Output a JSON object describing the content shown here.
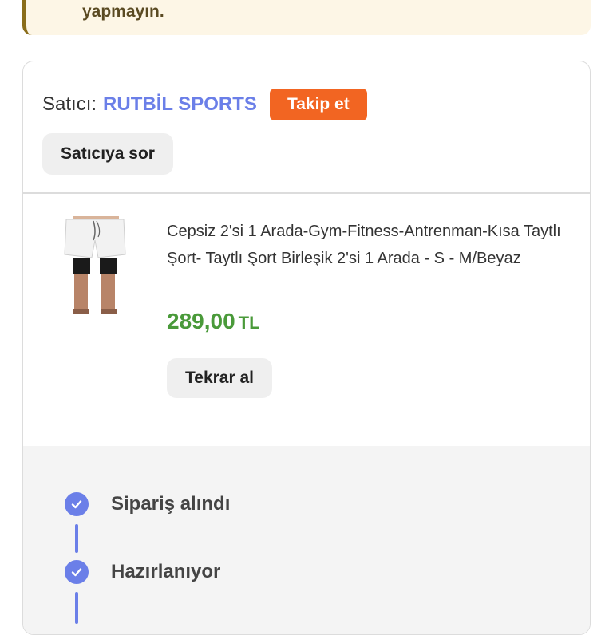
{
  "notice": {
    "text": "yapmayın."
  },
  "seller": {
    "prefix": "Satıcı:",
    "name": "RUTBİL SPORTS",
    "follow_label": "Takip et",
    "ask_label": "Satıcıya sor"
  },
  "product": {
    "title": "Cepsiz 2'si 1 Arada-Gym-Fitness-Antrenman-Kısa Taytlı Şort- Taytlı Şort Birleşik 2'si 1 Arada - S - M/Beyaz",
    "price": "289,00",
    "currency": "TL",
    "reorder_label": "Tekrar al"
  },
  "tracking": {
    "steps": [
      {
        "label": "Sipariş alındı",
        "icon": "check-icon"
      },
      {
        "label": "Hazırlanıyor",
        "icon": "check-icon"
      }
    ]
  },
  "colors": {
    "accent": "#6b7fe8",
    "follow": "#f26522",
    "price": "#4a9a3a",
    "notice_bg": "#fdf6e6"
  }
}
